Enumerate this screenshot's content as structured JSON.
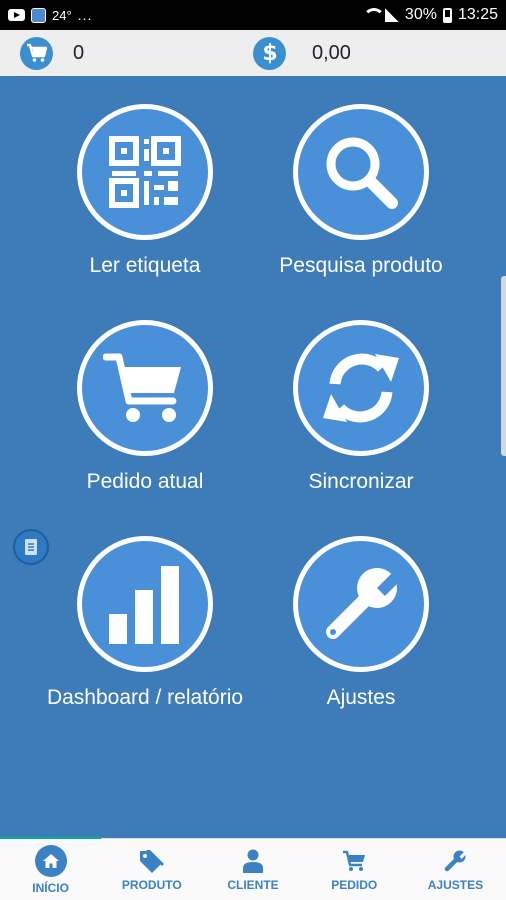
{
  "status_bar": {
    "temperature": "24°",
    "dots": "...",
    "battery": "30%",
    "time": "13:25"
  },
  "summary": {
    "cart_count": "0",
    "total_value": "0,00",
    "cart_icon": "cart-icon",
    "money_icon": "dollar-icon"
  },
  "tiles": [
    {
      "label": "Ler etiqueta",
      "icon": "qr-code-icon"
    },
    {
      "label": "Pesquisa produto",
      "icon": "search-icon"
    },
    {
      "label": "Pedido atual",
      "icon": "cart-icon"
    },
    {
      "label": "Sincronizar",
      "icon": "sync-icon"
    },
    {
      "label": "Dashboard / relatório",
      "icon": "bar-chart-icon"
    },
    {
      "label": "Ajustes",
      "icon": "wrench-icon"
    }
  ],
  "bottom_nav": {
    "active": "INÍCIO",
    "items": [
      {
        "label": "INÍCIO",
        "icon": "home-icon"
      },
      {
        "label": "PRODUTO",
        "icon": "tags-icon"
      },
      {
        "label": "CLIENTE",
        "icon": "user-icon"
      },
      {
        "label": "PEDIDO",
        "icon": "cart-icon"
      },
      {
        "label": "AJUSTES",
        "icon": "wrench-icon"
      }
    ]
  },
  "colors": {
    "background": "#3d7cb8",
    "tile_fill": "#4a90d9",
    "accent": "#3b82c4",
    "summary_bar": "#eeeeee"
  }
}
